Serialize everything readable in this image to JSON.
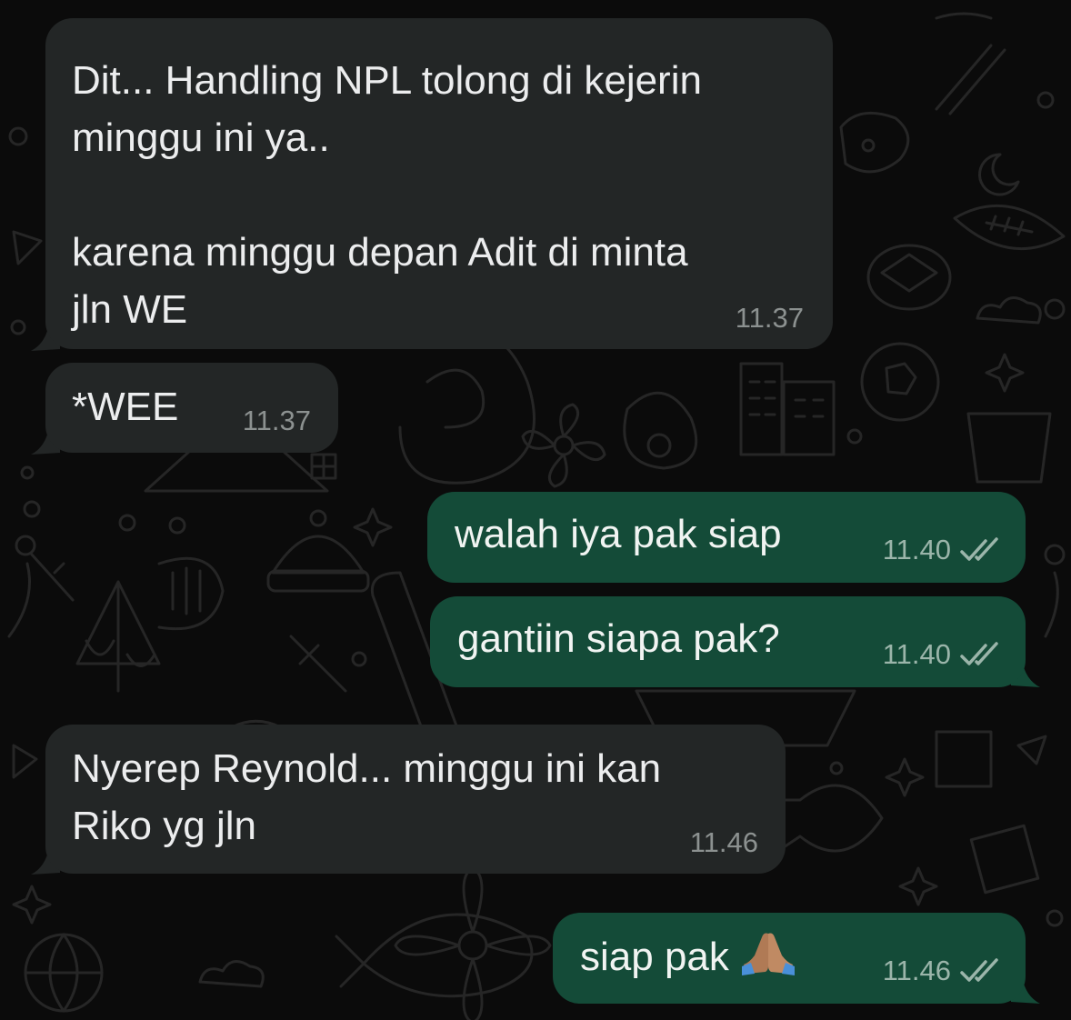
{
  "colors": {
    "background": "#0b0b0b",
    "incoming_bubble": "#232626",
    "outgoing_bubble": "#144b38",
    "read_receipt": "#9bb5aa"
  },
  "icons": {
    "read_receipt": "double-check-icon",
    "emoji": "folded-hands-emoji"
  },
  "messages": [
    {
      "direction": "incoming",
      "text": "Dit... Handling NPL tolong di kejerin\nminggu ini ya..\n\nkarena minggu depan Adit di minta\njln WE",
      "time": "11.37"
    },
    {
      "direction": "incoming",
      "text": "*WEE",
      "time": "11.37"
    },
    {
      "direction": "outgoing",
      "text": "walah iya pak siap",
      "time": "11.40",
      "status": "read"
    },
    {
      "direction": "outgoing",
      "text": "gantiin siapa pak?",
      "time": "11.40",
      "status": "read"
    },
    {
      "direction": "incoming",
      "text": "Nyerep Reynold... minggu ini kan\nRiko yg jln",
      "time": "11.46"
    },
    {
      "direction": "outgoing",
      "text": "siap pak",
      "emoji": "🙏🏽",
      "time": "11.46",
      "status": "read"
    }
  ]
}
